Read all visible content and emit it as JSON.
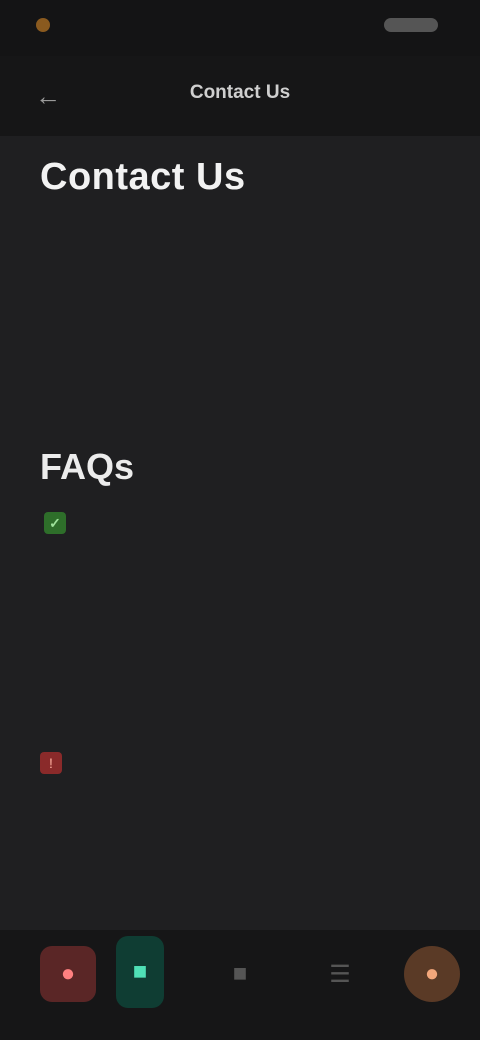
{
  "status_bar": {
    "left_text": "",
    "right_text": ""
  },
  "header": {
    "title": "Contact Us",
    "back_icon": "back-arrow-icon"
  },
  "contact_section": {
    "heading": "Contact Us",
    "paragraph_1_before_link": "",
    "paragraph_1_link": "",
    "paragraph_1_after_link": "",
    "paragraph_2": ""
  },
  "faq_section": {
    "heading": "FAQs",
    "checkbox_label": "",
    "paragraph": ""
  },
  "warning_section": {
    "text": ""
  },
  "bottom_nav": {
    "items": [
      {
        "icon": "home-icon"
      },
      {
        "icon": "chat-icon"
      },
      {
        "icon": "grid-icon"
      },
      {
        "icon": "list-icon"
      },
      {
        "icon": "profile-icon"
      }
    ]
  },
  "colors": {
    "background": "#1f1f21",
    "accent_green": "#3fae49",
    "warning_red": "#8a2a2a"
  }
}
